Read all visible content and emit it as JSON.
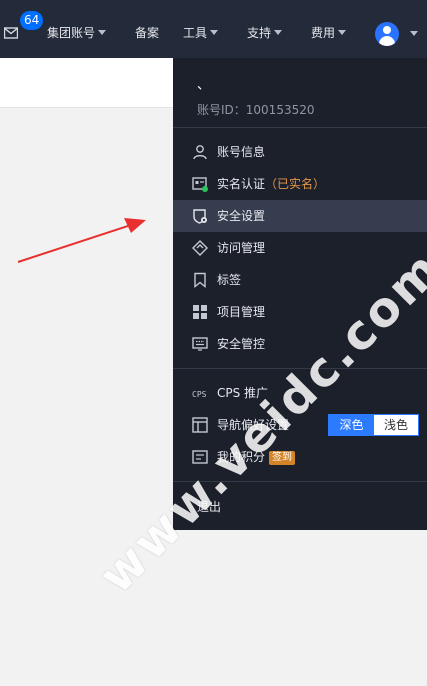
{
  "topbar": {
    "badge_count": "64",
    "nav": [
      "集团账号",
      "备案",
      "工具",
      "支持",
      "费用"
    ]
  },
  "account": {
    "name": "、",
    "uid": "账号ID：100153520"
  },
  "menu": {
    "items": [
      {
        "label": "账号信息",
        "icon": "user-icon"
      },
      {
        "label": "实名认证",
        "note": "（已实名）",
        "icon": "id-card-icon"
      },
      {
        "label": "安全设置",
        "icon": "shield-gear-icon"
      },
      {
        "label": "访问管理",
        "icon": "access-icon"
      },
      {
        "label": "标签",
        "icon": "bookmark-icon"
      },
      {
        "label": "项目管理",
        "icon": "project-icon"
      },
      {
        "label": "安全管控",
        "icon": "keyboard-icon"
      }
    ],
    "cps": "CPS 推广",
    "nav_pref": "导航偏好设置",
    "theme_dark": "深色",
    "theme_light": "浅色",
    "points": "我的积分",
    "sign_in": "签到",
    "logout": "退出"
  },
  "watermark": "www.veidc.com",
  "colors": {
    "header_bg": "#232a39",
    "menu_bg": "#1b202b",
    "active_bg": "#353d4e",
    "accent": "#2c7bff",
    "note": "#e4964b",
    "arrow": "#e8312f"
  }
}
